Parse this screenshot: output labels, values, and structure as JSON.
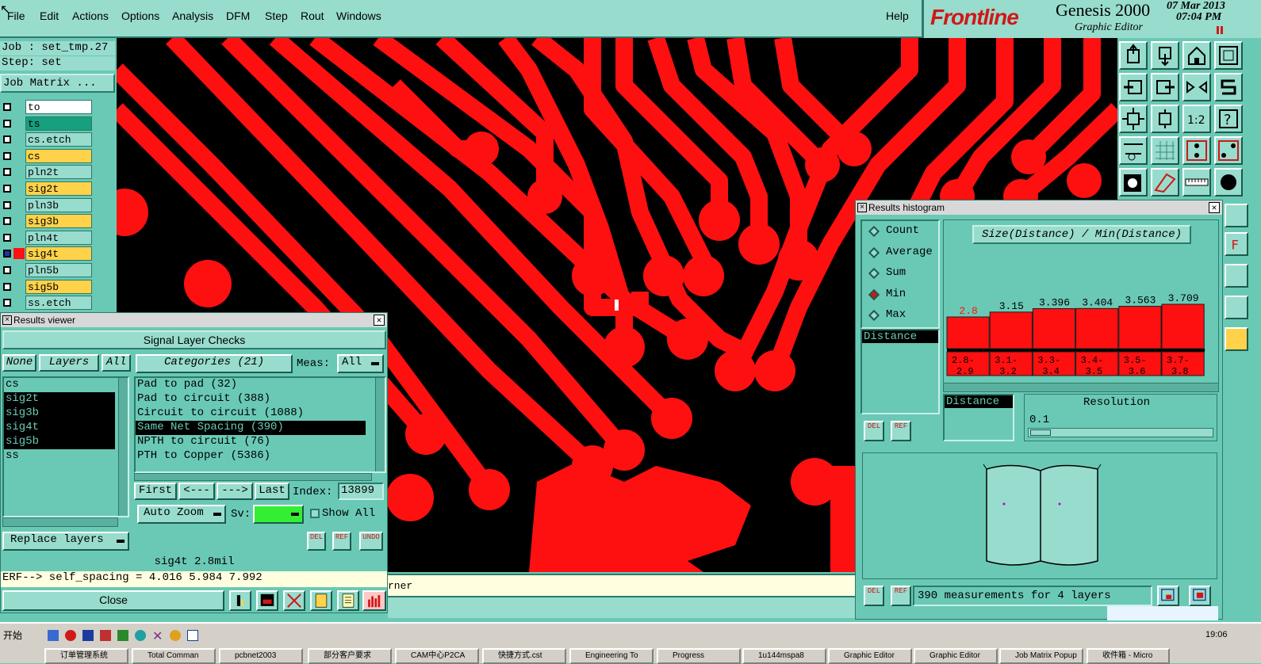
{
  "menubar": {
    "items": [
      "File",
      "Edit",
      "Actions",
      "Options",
      "Analysis",
      "DFM",
      "Step",
      "Rout",
      "Windows"
    ],
    "help": "Help"
  },
  "brand": {
    "logo": "Frontline",
    "app_title": "Genesis 2000",
    "subtitle": "Graphic Editor",
    "date": "07 Mar 2013",
    "time": "07:04 PM"
  },
  "job": {
    "job_line": "Job : set_tmp.27",
    "step_line": "Step: set",
    "matrix_button": "Job Matrix ..."
  },
  "layers": [
    {
      "name": "to",
      "color": "#ffffff"
    },
    {
      "name": "ts",
      "color": "#16a07d"
    },
    {
      "name": "cs.etch",
      "color": "#98dccd"
    },
    {
      "name": "cs",
      "color": "#ffd24a"
    },
    {
      "name": "pln2t",
      "color": "#98dccd"
    },
    {
      "name": "sig2t",
      "color": "#ffd24a"
    },
    {
      "name": "pln3b",
      "color": "#98dccd"
    },
    {
      "name": "sig3b",
      "color": "#ffd24a"
    },
    {
      "name": "pln4t",
      "color": "#98dccd"
    },
    {
      "name": "sig4t",
      "color": "#ffd24a"
    },
    {
      "name": "pln5b",
      "color": "#98dccd"
    },
    {
      "name": "sig5b",
      "color": "#ffd24a"
    },
    {
      "name": "ss.etch",
      "color": "#98dccd"
    }
  ],
  "results_viewer": {
    "title": "Results viewer",
    "header": "Signal Layer Checks",
    "none_btn": "None",
    "layers_btn": "Layers",
    "all_btn": "All",
    "categories_btn": "Categories (21)",
    "meas_label": "Meas:",
    "meas_value": "All",
    "layer_list": [
      "cs",
      "sig2t",
      "sig3b",
      "sig4t",
      "sig5b",
      "ss"
    ],
    "category_list": [
      "Pad to pad (32)",
      "Pad to circuit (388)",
      "Circuit to circuit (1088)",
      "Same Net Spacing (390)",
      "NPTH to circuit (76)",
      "PTH to Copper (5386)"
    ],
    "first_btn": "First",
    "prev_btn": "<---",
    "next_btn": "--->",
    "last_btn": "Last",
    "index_label": "Index:",
    "index_value": "13899",
    "autozoom": "Auto Zoom",
    "sv_label": "Sv:",
    "show_all": "Show All",
    "replace_layers": "Replace layers",
    "del": "DEL",
    "ref": "REF",
    "undo": "UNDO",
    "info_line": "sig4t 2.8mil",
    "erf_line": "ERF--> self_spacing = 4.016 5.984 7.992",
    "close_btn": "Close"
  },
  "cmdline": {
    "text": "rner"
  },
  "histogram": {
    "title": "Results histogram",
    "modes": [
      "Count",
      "Average",
      "Sum",
      "Min",
      "Max"
    ],
    "selected_mode": "Min",
    "header": "Size(Distance) / Min(Distance)",
    "param_item": "Distance",
    "del": "DEL",
    "ref": "REF",
    "distance_label": "Distance",
    "resolution_label": "Resolution",
    "resolution_value": "0.1",
    "summary": "390 measurements for 4 layers",
    "colors": {
      "bar": "#ff1010",
      "first_label": "#ff1010"
    }
  },
  "chart_data": {
    "type": "bar",
    "categories": [
      "2.8-2.9",
      "3.1-3.2",
      "3.3-3.4",
      "3.4-3.5",
      "3.5-3.6",
      "3.7-3.8"
    ],
    "values": [
      2.8,
      3.15,
      3.396,
      3.404,
      3.563,
      3.709
    ],
    "value_labels": [
      "2.8",
      "3.15",
      "3.396",
      "3.404",
      "3.563",
      "3.709"
    ],
    "title": "Size(Distance) / Min(Distance)",
    "ylim": [
      0,
      3.709
    ]
  },
  "taskbar": {
    "start": "开始",
    "clock": "19:06",
    "tasks": [
      "订单管理系统",
      "Total Comman",
      "pcbnet2003",
      "部分客户要求",
      "CAM中心P2CA",
      "快捷方式.cst",
      "Engineering To",
      "Progress",
      "1u144mspa8",
      "Graphic Editor",
      "Graphic Editor",
      "Job Matrix Popup",
      "收件箱 - Micro"
    ]
  }
}
